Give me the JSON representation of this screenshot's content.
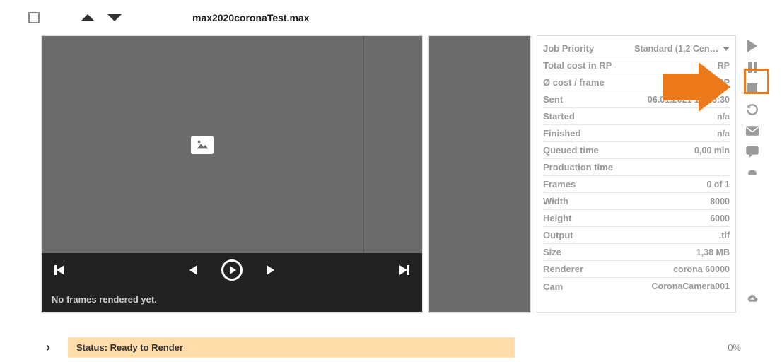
{
  "header": {
    "filename": "max2020coronaTest.max"
  },
  "preview": {
    "no_frames_msg": "No frames rendered yet."
  },
  "info": {
    "rows": [
      {
        "label": "Job Priority",
        "value": "Standard (1,2 Cen…",
        "dropdown": true
      },
      {
        "label": "Total cost in RP",
        "value": "RP"
      },
      {
        "label": "Ø cost / frame",
        "value": "RP"
      },
      {
        "label": "Sent",
        "value": "06.01.2021 12:25:30"
      },
      {
        "label": "Started",
        "value": "n/a"
      },
      {
        "label": "Finished",
        "value": "n/a"
      },
      {
        "label": "Queued time",
        "value": "0,00 min"
      },
      {
        "label": "Production time",
        "value": ""
      },
      {
        "label": "Frames",
        "value": "0 of 1"
      },
      {
        "label": "Width",
        "value": "8000"
      },
      {
        "label": "Height",
        "value": "6000"
      },
      {
        "label": "Output",
        "value": ".tif"
      },
      {
        "label": "Size",
        "value": "1,38 MB"
      },
      {
        "label": "Renderer",
        "value": "corona 60000"
      },
      {
        "label": "Cam",
        "value": "CoronaCamera001"
      }
    ]
  },
  "status": {
    "label": "Status: Ready to Render",
    "percent": "0%"
  }
}
